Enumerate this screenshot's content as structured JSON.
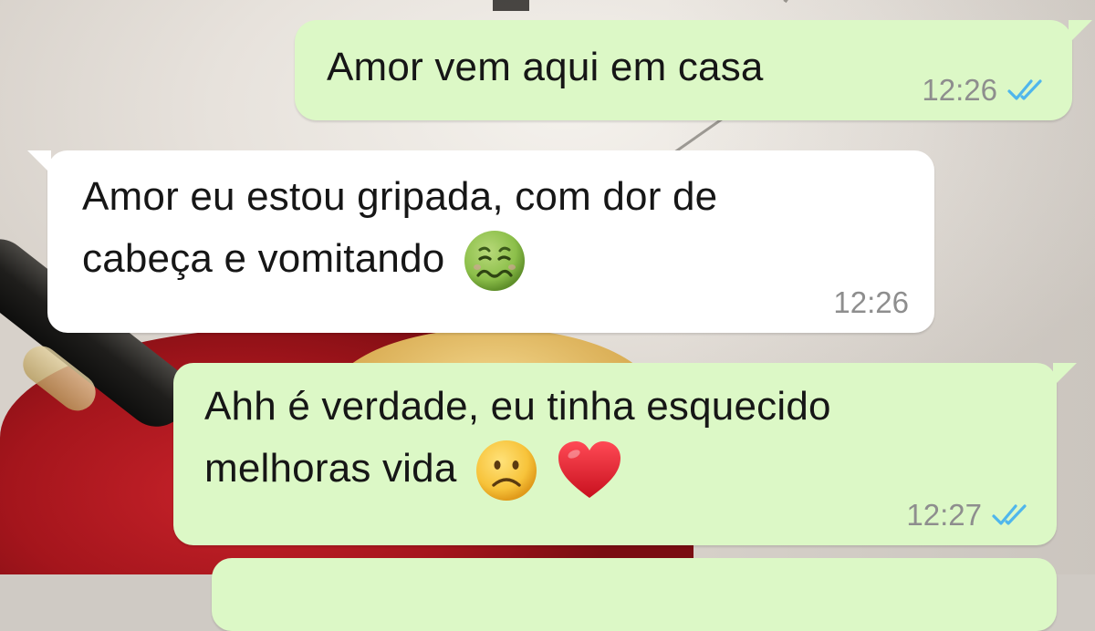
{
  "chat": {
    "messages": [
      {
        "direction": "outgoing",
        "lines": [
          "Amor vem aqui em casa"
        ],
        "time": "12:26",
        "status_icon": "double-check-read-icon"
      },
      {
        "direction": "incoming",
        "lines": [
          "Amor eu estou gripada, com dor de",
          "cabeça e vomitando"
        ],
        "emojis": [
          "nauseated-face-icon"
        ],
        "time": "12:26"
      },
      {
        "direction": "outgoing",
        "lines": [
          "Ahh é verdade, eu tinha esquecido",
          "melhoras vida"
        ],
        "emojis": [
          "frowning-face-icon",
          "red-heart-icon"
        ],
        "time": "12:27",
        "status_icon": "double-check-read-icon"
      },
      {
        "direction": "outgoing",
        "lines": [],
        "partial": true
      }
    ]
  },
  "colors": {
    "outgoing_bubble": "#dcf8c6",
    "incoming_bubble": "#ffffff",
    "read_ticks": "#4fb6ec",
    "timestamp": "#8e8e8e"
  }
}
